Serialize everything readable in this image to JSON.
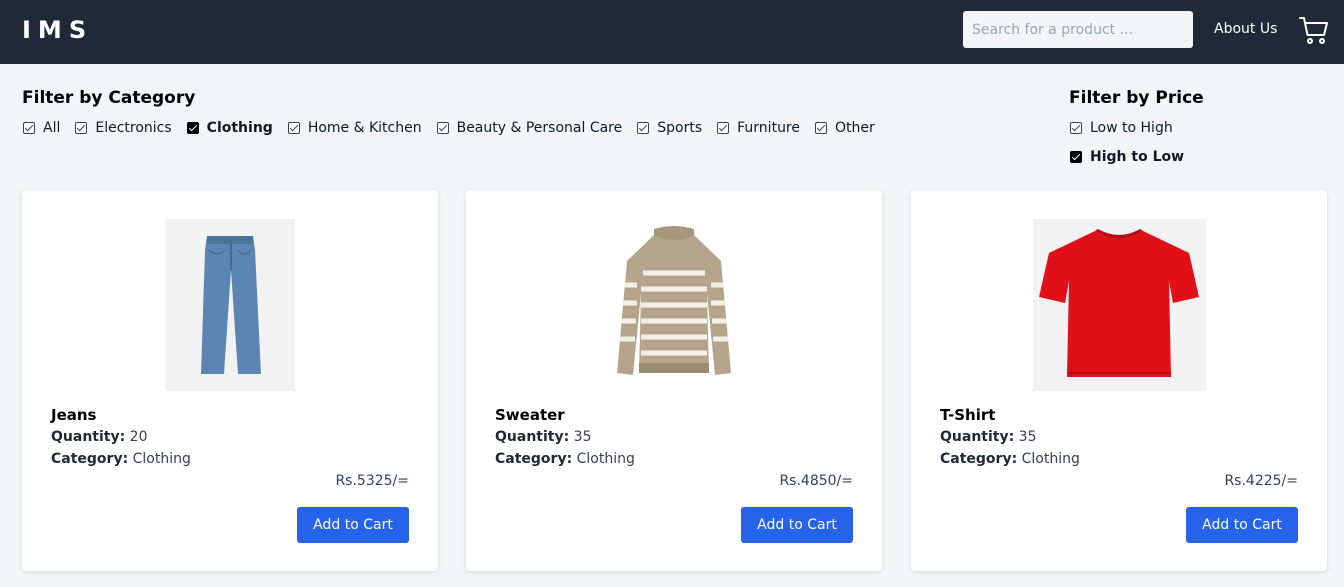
{
  "header": {
    "logo": "IMS",
    "search_placeholder": "Search for a product ...",
    "about": "About Us"
  },
  "category_filter": {
    "title": "Filter by Category",
    "items": [
      {
        "label": "All",
        "checked": false
      },
      {
        "label": "Electronics",
        "checked": false
      },
      {
        "label": "Clothing",
        "checked": true
      },
      {
        "label": "Home & Kitchen",
        "checked": false
      },
      {
        "label": "Beauty & Personal Care",
        "checked": false
      },
      {
        "label": "Sports",
        "checked": false
      },
      {
        "label": "Furniture",
        "checked": false
      },
      {
        "label": "Other",
        "checked": false
      }
    ]
  },
  "price_filter": {
    "title": "Filter by Price",
    "items": [
      {
        "label": "Low to High",
        "checked": false
      },
      {
        "label": "High to Low",
        "checked": true
      }
    ]
  },
  "labels": {
    "quantity": "Quantity:",
    "category": "Category:",
    "add_to_cart": "Add to Cart"
  },
  "products": [
    {
      "name": "Jeans",
      "quantity": "20",
      "category": "Clothing",
      "price": "Rs.5325/="
    },
    {
      "name": "Sweater",
      "quantity": "35",
      "category": "Clothing",
      "price": "Rs.4850/="
    },
    {
      "name": "T-Shirt",
      "quantity": "35",
      "category": "Clothing",
      "price": "Rs.4225/="
    }
  ],
  "colors": {
    "navbar": "#1f2937",
    "accent": "#2563eb",
    "background": "#f3f4f6"
  }
}
